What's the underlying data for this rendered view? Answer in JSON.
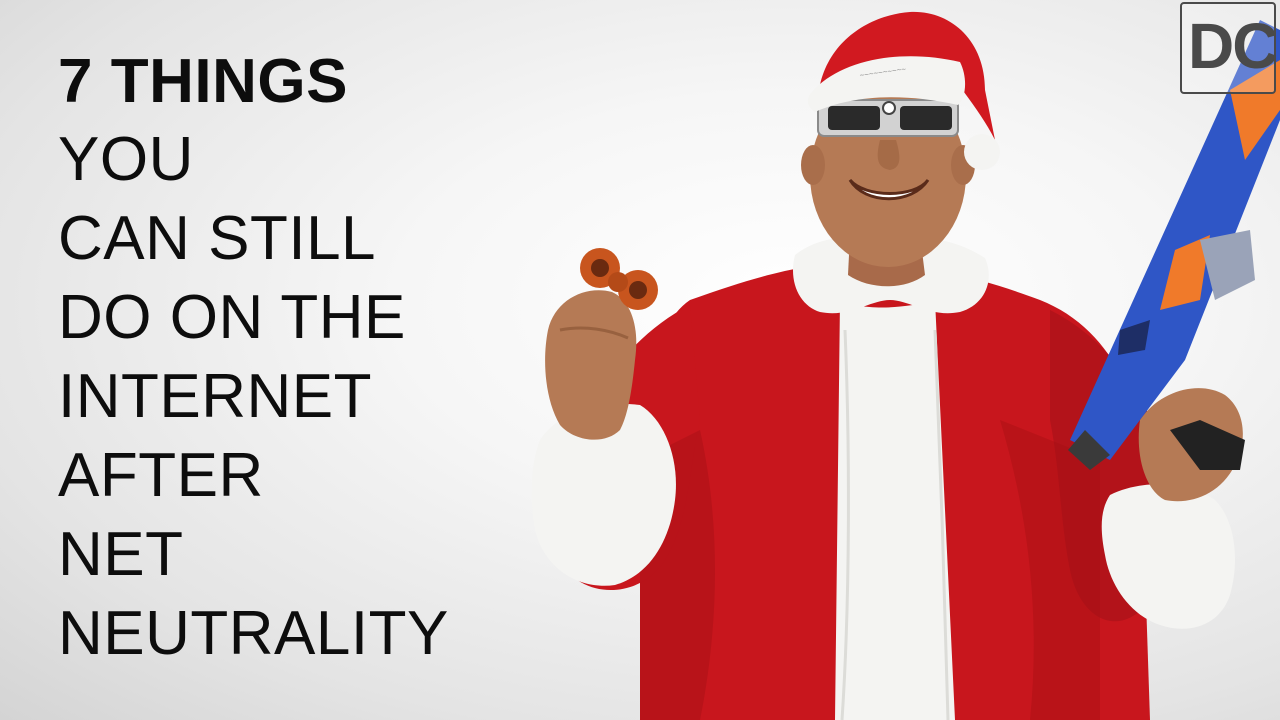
{
  "headline": {
    "bold_line": "7 THINGS",
    "lines": [
      "YOU",
      "CAN STILL",
      "DO ON THE",
      "INTERNET",
      "AFTER",
      "NET",
      "NEUTRALITY"
    ]
  },
  "logo": {
    "text": "DC"
  },
  "figure": {
    "description_icons": [
      "santa-hat-icon",
      "eclipse-glasses-icon",
      "fidget-spinner-icon",
      "toy-blaster-icon"
    ]
  },
  "colors": {
    "background": "#eeeeee",
    "text": "#0d0d0d",
    "suit_red": "#c8161d",
    "fur_white": "#f4f4f2",
    "blaster_blue": "#2f56c6",
    "blaster_orange": "#f07a2a",
    "spinner_orange": "#c8551e"
  }
}
